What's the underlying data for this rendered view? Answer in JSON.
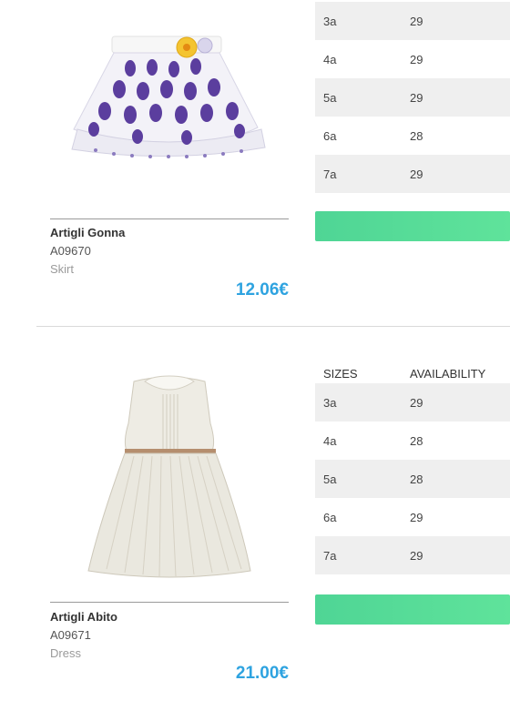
{
  "products": [
    {
      "name": "Artigli Gonna",
      "code": "A09670",
      "category": "Skirt",
      "price": "12.06€",
      "sizes_header": {
        "size": "",
        "availability": ""
      },
      "sizes": [
        {
          "size": "3a",
          "availability": "29"
        },
        {
          "size": "4a",
          "availability": "29"
        },
        {
          "size": "5a",
          "availability": "29"
        },
        {
          "size": "6a",
          "availability": "28"
        },
        {
          "size": "7a",
          "availability": "29"
        }
      ]
    },
    {
      "name": "Artigli Abito",
      "code": "A09671",
      "category": "Dress",
      "price": "21.00€",
      "sizes_header": {
        "size": "SIZES",
        "availability": "AVAILABILITY"
      },
      "sizes": [
        {
          "size": "3a",
          "availability": "29"
        },
        {
          "size": "4a",
          "availability": "28"
        },
        {
          "size": "5a",
          "availability": "28"
        },
        {
          "size": "6a",
          "availability": "29"
        },
        {
          "size": "7a",
          "availability": "29"
        }
      ]
    }
  ]
}
